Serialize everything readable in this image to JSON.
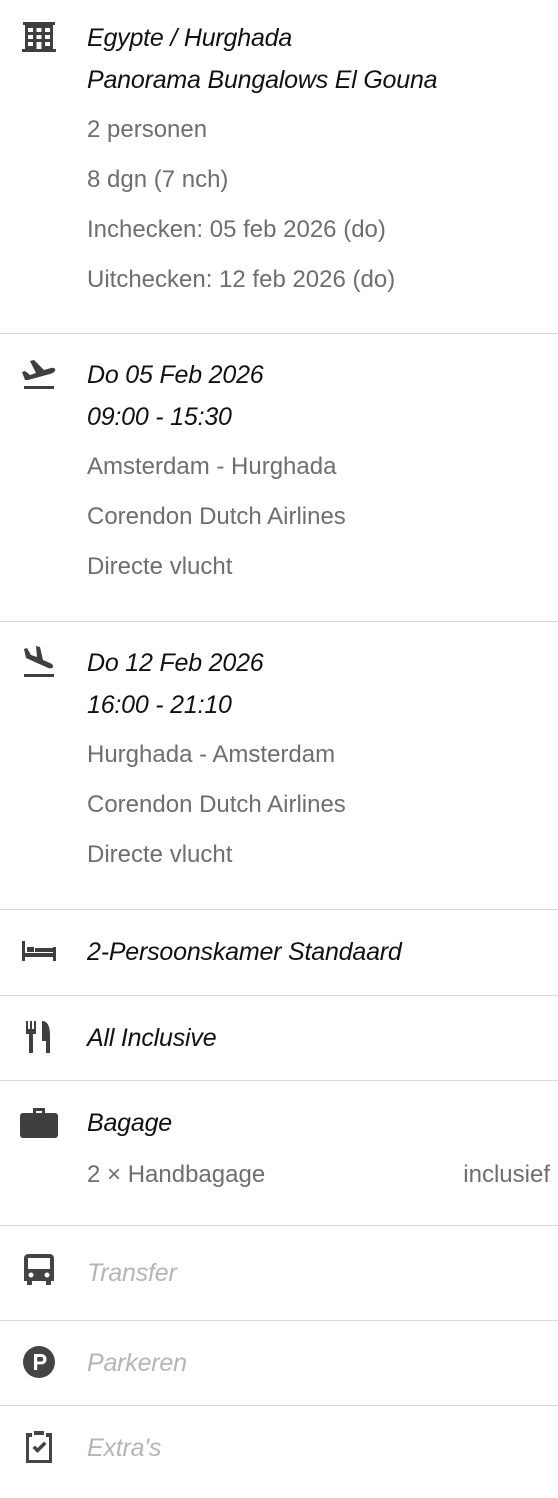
{
  "hotel": {
    "location": "Egypte / Hurghada",
    "name": "Panorama Bungalows El Gouna",
    "persons": "2 personen",
    "duration": "8 dgn (7 nch)",
    "checkin": "Inchecken: 05 feb 2026 (do)",
    "checkout": "Uitchecken: 12 feb 2026 (do)",
    "icon": "building-icon"
  },
  "outbound": {
    "date": "Do 05 Feb 2026",
    "time": "09:00 - 15:30",
    "route": "Amsterdam - Hurghada",
    "airline": "Corendon Dutch Airlines",
    "type": "Directe vlucht",
    "icon": "plane-departure-icon"
  },
  "inbound": {
    "date": "Do 12 Feb 2026",
    "time": "16:00 - 21:10",
    "route": "Hurghada - Amsterdam",
    "airline": "Corendon Dutch Airlines",
    "type": "Directe vlucht",
    "icon": "plane-arrival-icon"
  },
  "room": {
    "label": "2-Persoonskamer Standaard",
    "icon": "bed-icon"
  },
  "board": {
    "label": "All Inclusive",
    "icon": "cutlery-icon"
  },
  "baggage": {
    "label": "Bagage",
    "items": [
      {
        "name": "2 × Handbagage",
        "status": "inclusief"
      }
    ],
    "icon": "suitcase-icon"
  },
  "transfer": {
    "label": "Transfer",
    "icon": "bus-icon"
  },
  "parking": {
    "label": "Parkeren",
    "icon": "parking-icon"
  },
  "extras": {
    "label": "Extra's",
    "icon": "clipboard-check-icon"
  },
  "colors": {
    "title": "#111111",
    "detail": "#6e6e6e",
    "disabled": "#b5b5b5",
    "divider": "#d9d9d9",
    "icon": "#3f3f3f"
  }
}
